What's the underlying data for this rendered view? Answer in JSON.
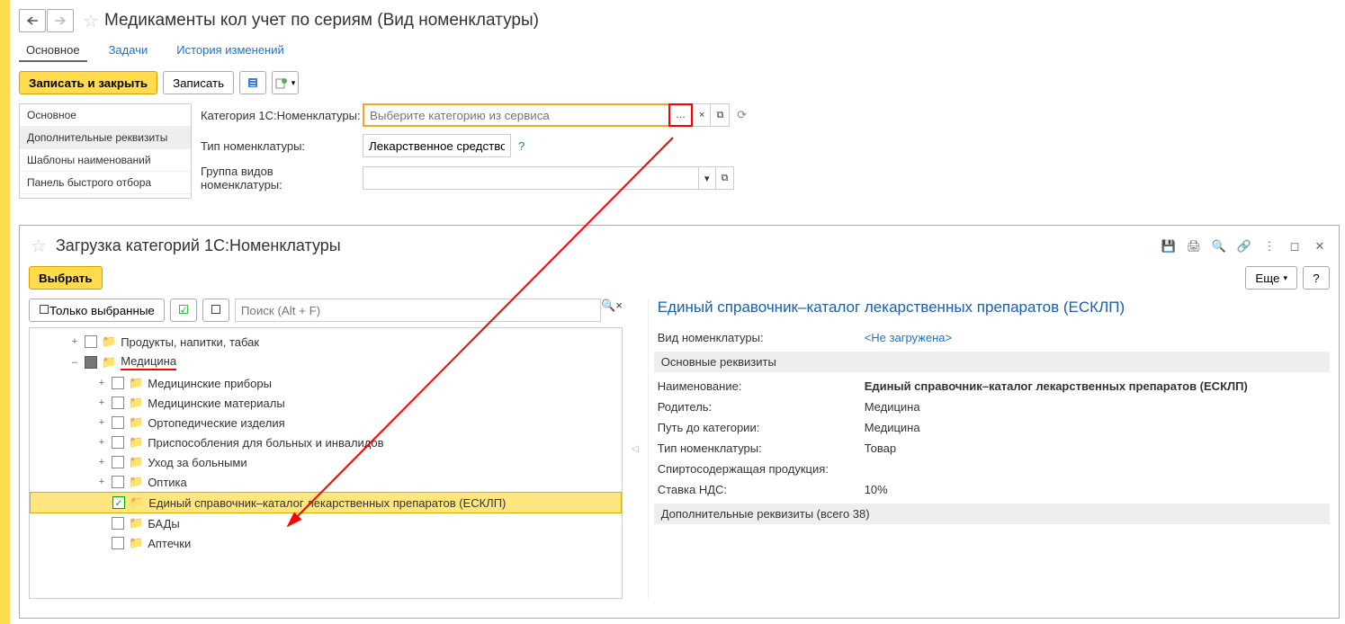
{
  "header": {
    "title": "Медикаменты кол учет по сериям (Вид номенклатуры)"
  },
  "tabs": {
    "main": "Основное",
    "tasks": "Задачи",
    "history": "История изменений"
  },
  "toolbar": {
    "save_close": "Записать и закрыть",
    "save": "Записать"
  },
  "sidebar": {
    "items": [
      "Основное",
      "Дополнительные реквизиты",
      "Шаблоны наименований",
      "Панель быстрого отбора"
    ]
  },
  "form": {
    "category_label": "Категория 1С:Номенклатуры:",
    "category_placeholder": "Выберите категорию из сервиса",
    "type_label": "Тип номенклатуры:",
    "type_value": "Лекарственное средство",
    "group_label_1": "Группа видов",
    "group_label_2": "номенклатуры:"
  },
  "modal": {
    "title": "Загрузка категорий 1С:Номенклатуры",
    "select": "Выбрать",
    "more": "Еще",
    "only_selected": "Только выбранные",
    "search_placeholder": "Поиск (Alt + F)",
    "tree": [
      {
        "label": "Продукты, напитки, табак",
        "depth": 1,
        "exp": "+",
        "chk": ""
      },
      {
        "label": "Медицина",
        "depth": 1,
        "exp": "–",
        "chk": "filled",
        "underline": true
      },
      {
        "label": "Медицинские приборы",
        "depth": 2,
        "exp": "+",
        "chk": ""
      },
      {
        "label": "Медицинские материалы",
        "depth": 2,
        "exp": "+",
        "chk": ""
      },
      {
        "label": "Ортопедические изделия",
        "depth": 2,
        "exp": "+",
        "chk": ""
      },
      {
        "label": "Приспособления для больных и инвалидов",
        "depth": 2,
        "exp": "+",
        "chk": ""
      },
      {
        "label": "Уход за больными",
        "depth": 2,
        "exp": "+",
        "chk": ""
      },
      {
        "label": "Оптика",
        "depth": 2,
        "exp": "+",
        "chk": ""
      },
      {
        "label": "Единый справочник–каталог лекарственных препаратов (ЕСКЛП)",
        "depth": 2,
        "exp": "",
        "chk": "green",
        "selected": true
      },
      {
        "label": "БАДы",
        "depth": 2,
        "exp": "",
        "chk": ""
      },
      {
        "label": "Аптечки",
        "depth": 2,
        "exp": "",
        "chk": ""
      }
    ],
    "details": {
      "title": "Единый справочник–каталог лекарственных препаратов (ЕСКЛП)",
      "kind_label": "Вид номенклатуры:",
      "kind_value": "<Не загружена>",
      "section1": "Основные реквизиты",
      "name_label": "Наименование:",
      "name_value": "Единый справочник–каталог лекарственных препаратов (ЕСКЛП)",
      "parent_label": "Родитель:",
      "parent_value": "Медицина",
      "path_label": "Путь до категории:",
      "path_value": "Медицина",
      "type_label": "Тип номенклатуры:",
      "type_value": "Товар",
      "alcohol_label": "Спиртосодержащая продукция:",
      "alcohol_value": "",
      "vat_label": "Ставка НДС:",
      "vat_value": "10%",
      "section2": "Дополнительные реквизиты (всего 38)"
    }
  }
}
